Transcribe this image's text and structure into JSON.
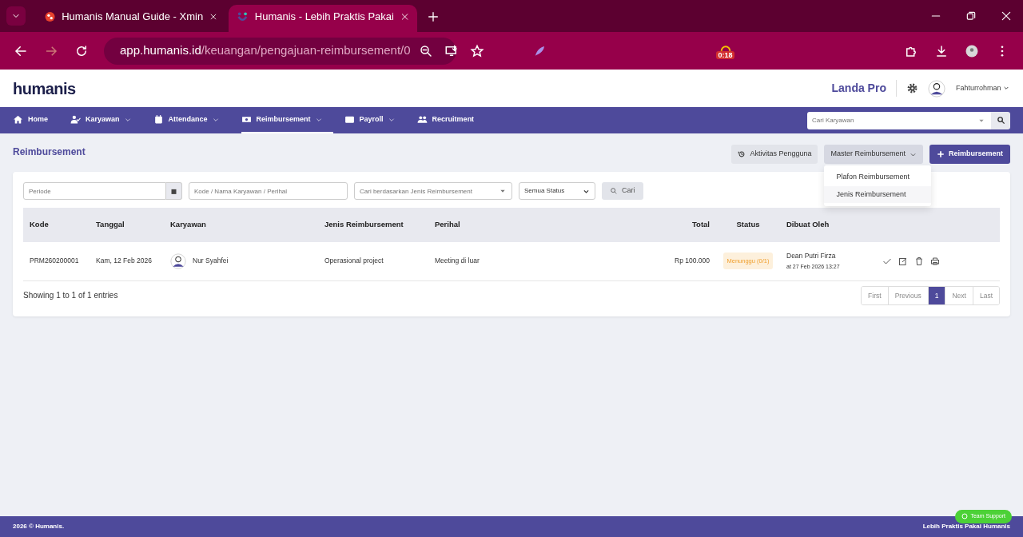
{
  "browser": {
    "tabs": [
      {
        "title": "Humanis Manual Guide - Xmin",
        "selected": false
      },
      {
        "title": "Humanis - Lebih Praktis Pakai",
        "selected": true
      }
    ],
    "url_host": "app.humanis.id",
    "url_path": "/keuangan/pengajuan-reimbursement/0",
    "extension_badge": "0:18"
  },
  "header": {
    "logo": "humanis",
    "company": "Landa Pro",
    "user": "Fahturrohman"
  },
  "nav": {
    "items": [
      {
        "label": "Home",
        "dropdown": false,
        "selected": false
      },
      {
        "label": "Karyawan",
        "dropdown": true,
        "selected": false
      },
      {
        "label": "Attendance",
        "dropdown": true,
        "selected": false
      },
      {
        "label": "Reimbursement",
        "dropdown": true,
        "selected": true
      },
      {
        "label": "Payroll",
        "dropdown": true,
        "selected": false
      },
      {
        "label": "Recruitment",
        "dropdown": false,
        "selected": false
      }
    ],
    "search": {
      "placeholder": "Cari Karyawan"
    }
  },
  "page": {
    "title": "Reimbursement",
    "buttons": {
      "activity": "Aktivitas Pengguna",
      "master": "Master Reimbursement",
      "add": "Reimbursement"
    },
    "master_menu": {
      "expanded": true,
      "items": [
        {
          "label": "Plafon Reimbursement",
          "selected": false
        },
        {
          "label": "Jenis Reimbursement",
          "selected": true
        }
      ]
    }
  },
  "filters": {
    "periode": {
      "placeholder": "Periode"
    },
    "search": {
      "placeholder": "Kode / Nama Karyawan / Perihal"
    },
    "jenis": {
      "placeholder": "Cari berdasarkan Jenis Reimbursement"
    },
    "status": "Semua Status",
    "submit": "Cari"
  },
  "table": {
    "columns": [
      "Kode",
      "Tanggal",
      "Karyawan",
      "Jenis Reimbursement",
      "Perihal",
      "Total",
      "Status",
      "Dibuat Oleh"
    ],
    "rows": [
      {
        "kode": "PRM260200001",
        "tanggal": "Kam, 12 Feb 2026",
        "karyawan": "Nur Syahfei",
        "jenis": "Operasional project",
        "perihal": "Meeting di luar",
        "total": "Rp 100.000",
        "status": "Menunggu (0/1)",
        "dibuat_oleh": "Dean Putri Firza",
        "dibuat_pada": "at 27 Feb 2026 13:27"
      }
    ]
  },
  "info": "Showing 1 to 1 of 1 entries",
  "pagination": [
    {
      "label": "First",
      "disabled": true,
      "selected": false
    },
    {
      "label": "Previous",
      "disabled": true,
      "selected": false
    },
    {
      "label": "1",
      "disabled": false,
      "selected": true
    },
    {
      "label": "Next",
      "disabled": true,
      "selected": false
    },
    {
      "label": "Last",
      "disabled": true,
      "selected": false
    }
  ],
  "footer": {
    "left": "2026 © Humanis.",
    "right": "Lebih Praktis Pakai Humanis",
    "support": "Team Support"
  }
}
